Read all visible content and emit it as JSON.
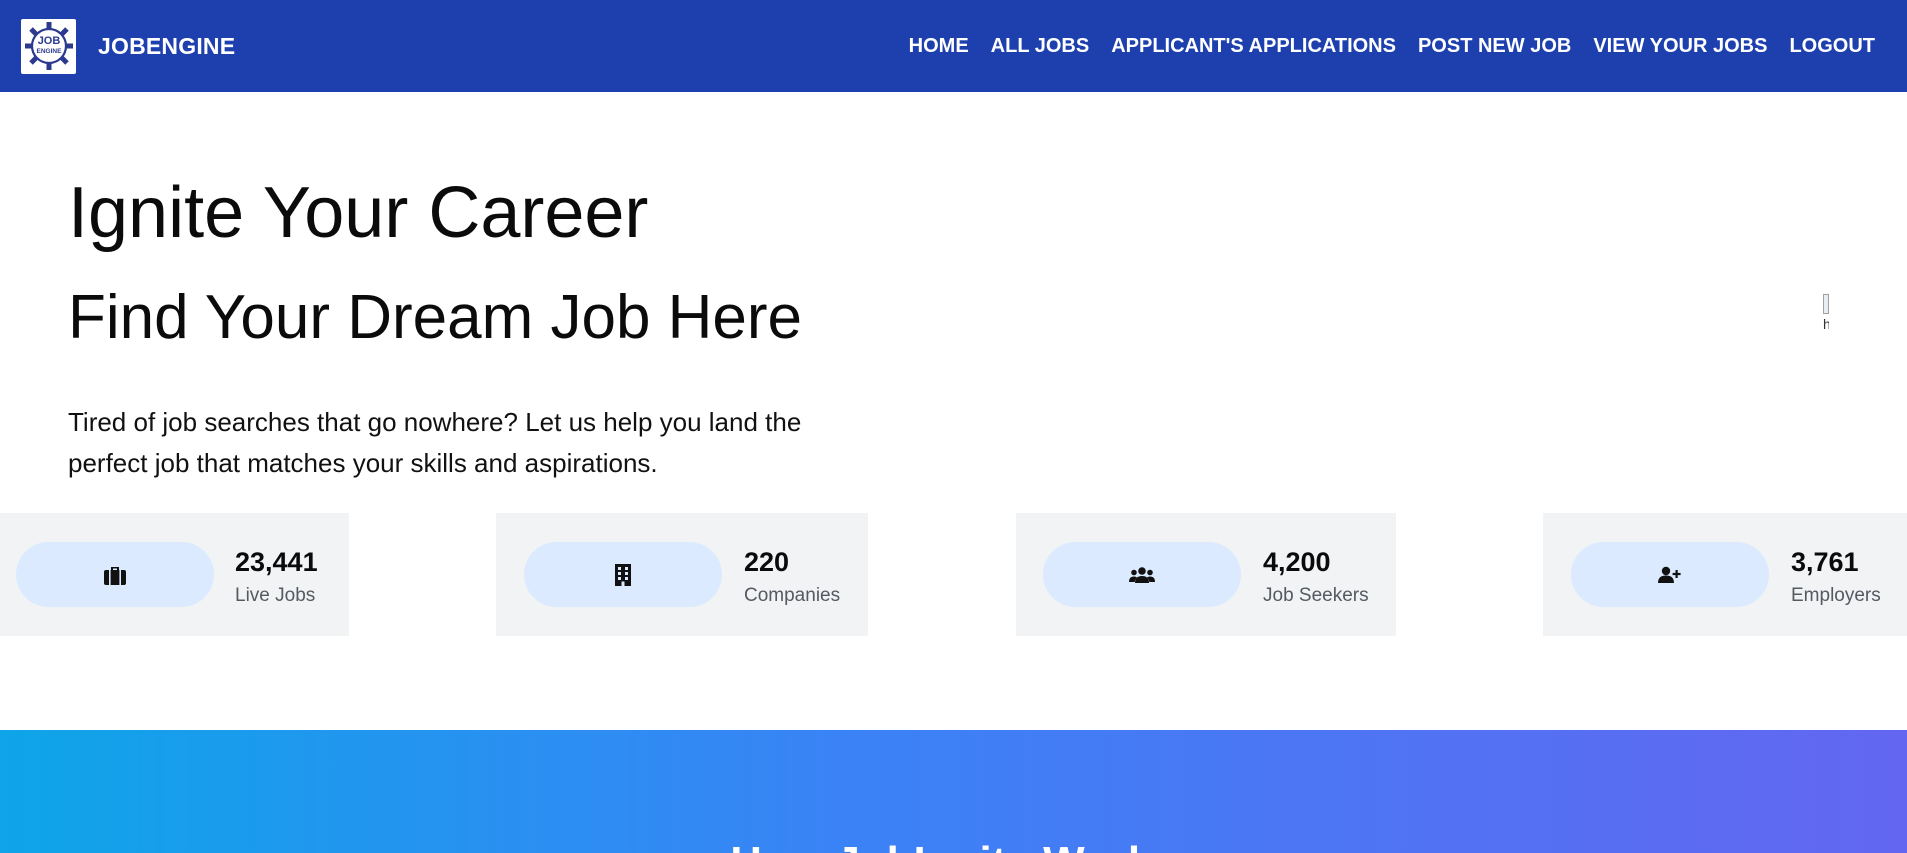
{
  "nav": {
    "logo_text": "JOB ENGINE",
    "brand": "JOBENGINE",
    "links": [
      {
        "label": "HOME"
      },
      {
        "label": "ALL JOBS"
      },
      {
        "label": "APPLICANT'S APPLICATIONS"
      },
      {
        "label": "POST NEW JOB"
      },
      {
        "label": "VIEW YOUR JOBS"
      },
      {
        "label": "LOGOUT"
      }
    ]
  },
  "hero": {
    "title": "Ignite Your Career",
    "subtitle": "Find Your Dream Job Here",
    "description": "Tired of job searches that go nowhere? Let us help you land the perfect job that matches your skills and aspirations.",
    "image_alt": "h"
  },
  "stats": [
    {
      "value": "23,441",
      "label": "Live Jobs",
      "icon": "briefcase-icon"
    },
    {
      "value": "220",
      "label": "Companies",
      "icon": "building-icon"
    },
    {
      "value": "4,200",
      "label": "Job Seekers",
      "icon": "users-icon"
    },
    {
      "value": "3,761",
      "label": "Employers",
      "icon": "user-plus-icon"
    }
  ],
  "how": {
    "title": "How JobIgnite Works"
  },
  "colors": {
    "navbar": "#1e40af",
    "stat_card": "#f1f3f5",
    "stat_pill": "#dbeafe",
    "gradient_start": "#0ea5e9",
    "gradient_end": "#6366f1"
  }
}
